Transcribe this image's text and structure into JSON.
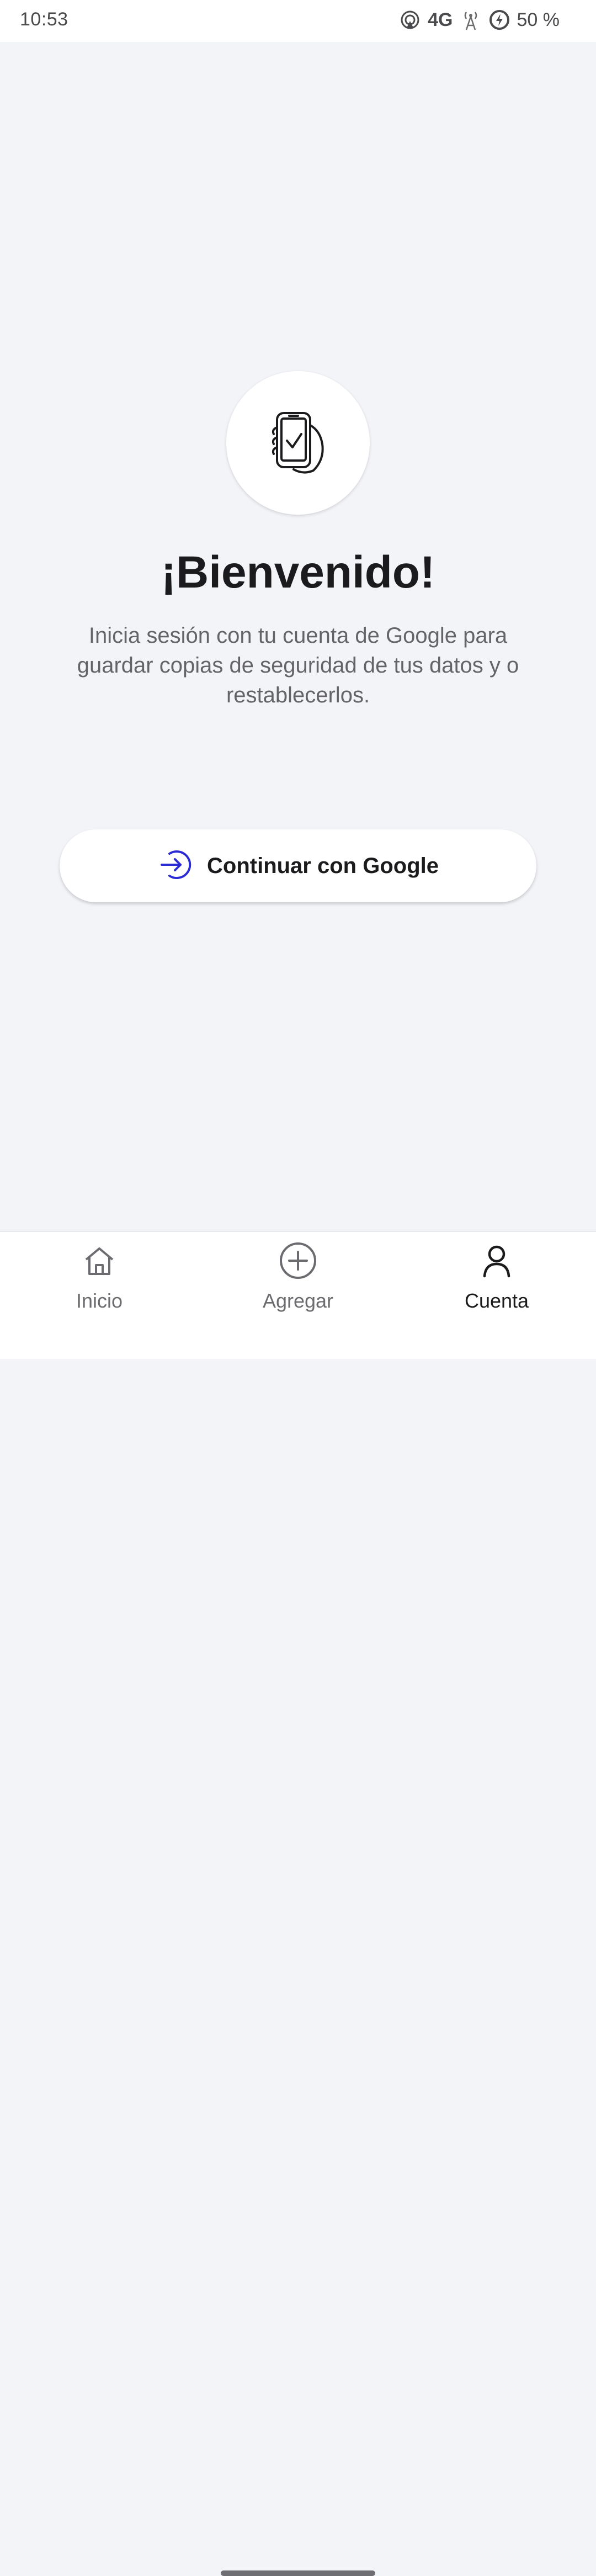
{
  "status_bar": {
    "time": "10:53",
    "network": "4G",
    "battery": "50 %"
  },
  "main": {
    "title": "¡Bienvenido!",
    "description": "Inicia sesión con tu cuenta de Google para guardar copias de seguridad de tus datos y o restablecerlos.",
    "hero_icon": "phone-check-icon",
    "button": {
      "label": "Continuar con Google",
      "icon": "login-arrow-icon",
      "icon_color": "#2b2bd6"
    }
  },
  "bottom_nav": {
    "items": [
      {
        "label": "Inicio",
        "icon": "home-icon"
      },
      {
        "label": "Agregar",
        "icon": "add-circle-icon"
      },
      {
        "label": "Cuenta",
        "icon": "person-icon"
      }
    ],
    "active": "Cuenta"
  }
}
